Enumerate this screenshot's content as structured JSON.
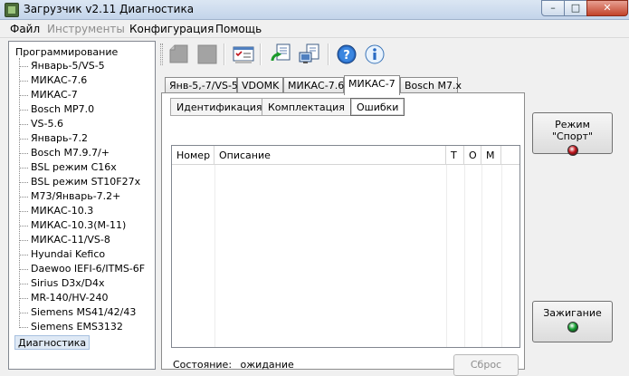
{
  "window": {
    "title": "Загрузчик v2.11 Диагностика",
    "btn_min": "–",
    "btn_max": "□",
    "btn_close": "✕"
  },
  "menu": [
    "Файл",
    "Инструменты",
    "Конфигурация",
    "Помощь"
  ],
  "tree": {
    "root": "Программирование",
    "items": [
      "Январь-5/VS-5",
      "МИКАС-7.6",
      "МИКАС-7",
      "Bosch MP7.0",
      "VS-5.6",
      "Январь-7.2",
      "Bosch M7.9.7/+",
      "BSL режим C16x",
      "BSL режим ST10F27x",
      "M73/Январь-7.2+",
      "МИКАС-10.3",
      "МИКАС-10.3(М-11)",
      "МИКАС-11/VS-8",
      "Hyundai Kefico",
      "Daewoo IEFI-6/ITMS-6F",
      "Sirius D3x/D4x",
      "MR-140/HV-240",
      "Siemens MS41/42/43",
      "Siemens EMS3132"
    ],
    "selected": "Диагностика"
  },
  "toolbar": {
    "icons": [
      "chip-read-icon",
      "stop-icon",
      "checklist-icon",
      "refresh-doc-icon",
      "monitor-doc-icon",
      "help-icon",
      "info-icon"
    ]
  },
  "tabs": {
    "outer": [
      "Янв-5,-7/VS-5",
      "VDOMK",
      "МИКАС-7.6",
      "МИКАС-7",
      "Bosch M7.x"
    ],
    "outer_active": 3,
    "inner": [
      "Идентификация",
      "Комплектация",
      "Ошибки"
    ],
    "inner_active": 2
  },
  "grid": {
    "columns": [
      "Номер",
      "Описание",
      "T",
      "O",
      "M"
    ]
  },
  "status": {
    "label": "Состояние:",
    "value": "ожидание"
  },
  "buttons": {
    "reset": "Сброс",
    "sport": "Режим \"Спорт\"",
    "ignition": "Зажигание"
  },
  "colors": {
    "sport_led": "#c0121a",
    "ignition_led": "#13a030",
    "selection": "#dfe9f5"
  }
}
